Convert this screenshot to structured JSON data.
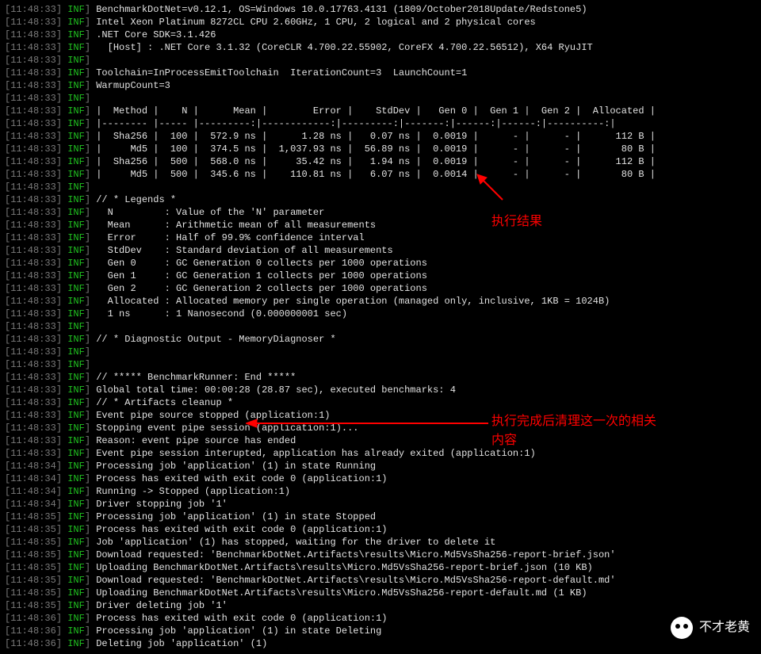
{
  "timestamp_default": "11:48:33",
  "level": "INF",
  "header": [
    "BenchmarkDotNet=v0.12.1, OS=Windows 10.0.17763.4131 (1809/October2018Update/Redstone5)",
    "Intel Xeon Platinum 8272CL CPU 2.60GHz, 1 CPU, 2 logical and 2 physical cores",
    ".NET Core SDK=3.1.426",
    "  [Host] : .NET Core 3.1.32 (CoreCLR 4.700.22.55902, CoreFX 4.700.22.56512), X64 RyuJIT",
    "",
    "Toolchain=InProcessEmitToolchain  IterationCount=3  LaunchCount=1",
    "WarmupCount=3",
    ""
  ],
  "table": {
    "columns": [
      "Method",
      "N",
      "Mean",
      "Error",
      "StdDev",
      "Gen 0",
      "Gen 1",
      "Gen 2",
      "Allocated"
    ],
    "rows": [
      {
        "Method": "Sha256",
        "N": "100",
        "Mean": "572.9 ns",
        "Error": "1.28 ns",
        "StdDev": "0.07 ns",
        "Gen0": "0.0019",
        "Gen1": "-",
        "Gen2": "-",
        "Allocated": "112 B"
      },
      {
        "Method": "Md5",
        "N": "100",
        "Mean": "374.5 ns",
        "Error": "1,037.93 ns",
        "StdDev": "56.89 ns",
        "Gen0": "0.0019",
        "Gen1": "-",
        "Gen2": "-",
        "Allocated": "80 B"
      },
      {
        "Method": "Sha256",
        "N": "500",
        "Mean": "568.0 ns",
        "Error": "35.42 ns",
        "StdDev": "1.94 ns",
        "Gen0": "0.0019",
        "Gen1": "-",
        "Gen2": "-",
        "Allocated": "112 B"
      },
      {
        "Method": "Md5",
        "N": "500",
        "Mean": "345.6 ns",
        "Error": "110.81 ns",
        "StdDev": "6.07 ns",
        "Gen0": "0.0014",
        "Gen1": "-",
        "Gen2": "-",
        "Allocated": "80 B"
      }
    ]
  },
  "legends_title": "// * Legends *",
  "legends": [
    {
      "k": "N",
      "v": "Value of the 'N' parameter"
    },
    {
      "k": "Mean",
      "v": "Arithmetic mean of all measurements"
    },
    {
      "k": "Error",
      "v": "Half of 99.9% confidence interval"
    },
    {
      "k": "StdDev",
      "v": "Standard deviation of all measurements"
    },
    {
      "k": "Gen 0",
      "v": "GC Generation 0 collects per 1000 operations"
    },
    {
      "k": "Gen 1",
      "v": "GC Generation 1 collects per 1000 operations"
    },
    {
      "k": "Gen 2",
      "v": "GC Generation 2 collects per 1000 operations"
    },
    {
      "k": "Allocated",
      "v": "Allocated memory per single operation (managed only, inclusive, 1KB = 1024B)"
    },
    {
      "k": "1 ns",
      "v": "1 Nanosecond (0.000000001 sec)"
    }
  ],
  "diag": "// * Diagnostic Output - MemoryDiagnoser *",
  "runner_end": "// ***** BenchmarkRunner: End *****",
  "global": "Global total time: 00:00:28 (28.87 sec), executed benchmarks: 4",
  "cleanup": "// * Artifacts cleanup *",
  "trailing": [
    {
      "t": "11:48:33",
      "m": "Event pipe source stopped (application:1)"
    },
    {
      "t": "11:48:33",
      "m": "Stopping event pipe session (application:1)..."
    },
    {
      "t": "11:48:33",
      "m": "Reason: event pipe source has ended"
    },
    {
      "t": "11:48:33",
      "m": "Event pipe session interupted, application has already exited (application:1)"
    },
    {
      "t": "11:48:34",
      "m": "Processing job 'application' (1) in state Running"
    },
    {
      "t": "11:48:34",
      "m": "Process has exited with exit code 0 (application:1)"
    },
    {
      "t": "11:48:34",
      "m": "Running -> Stopped (application:1)"
    },
    {
      "t": "11:48:34",
      "m": "Driver stopping job '1'"
    },
    {
      "t": "11:48:35",
      "m": "Processing job 'application' (1) in state Stopped"
    },
    {
      "t": "11:48:35",
      "m": "Process has exited with exit code 0 (application:1)"
    },
    {
      "t": "11:48:35",
      "m": "Job 'application' (1) has stopped, waiting for the driver to delete it"
    },
    {
      "t": "11:48:35",
      "m": "Download requested: 'BenchmarkDotNet.Artifacts\\results\\Micro.Md5VsSha256-report-brief.json'"
    },
    {
      "t": "11:48:35",
      "m": "Uploading BenchmarkDotNet.Artifacts\\results\\Micro.Md5VsSha256-report-brief.json (10 KB)"
    },
    {
      "t": "11:48:35",
      "m": "Download requested: 'BenchmarkDotNet.Artifacts\\results\\Micro.Md5VsSha256-report-default.md'"
    },
    {
      "t": "11:48:35",
      "m": "Uploading BenchmarkDotNet.Artifacts\\results\\Micro.Md5VsSha256-report-default.md (1 KB)"
    },
    {
      "t": "11:48:35",
      "m": "Driver deleting job '1'"
    },
    {
      "t": "11:48:36",
      "m": "Process has exited with exit code 0 (application:1)"
    },
    {
      "t": "11:48:36",
      "m": "Processing job 'application' (1) in state Deleting"
    },
    {
      "t": "11:48:36",
      "m": "Deleting job 'application' (1)"
    }
  ],
  "annotations": {
    "a1": "执行结果",
    "a2_l1": "执行完成后清理这一次的相关",
    "a2_l2": "内容"
  },
  "watermark": "不才老黄"
}
